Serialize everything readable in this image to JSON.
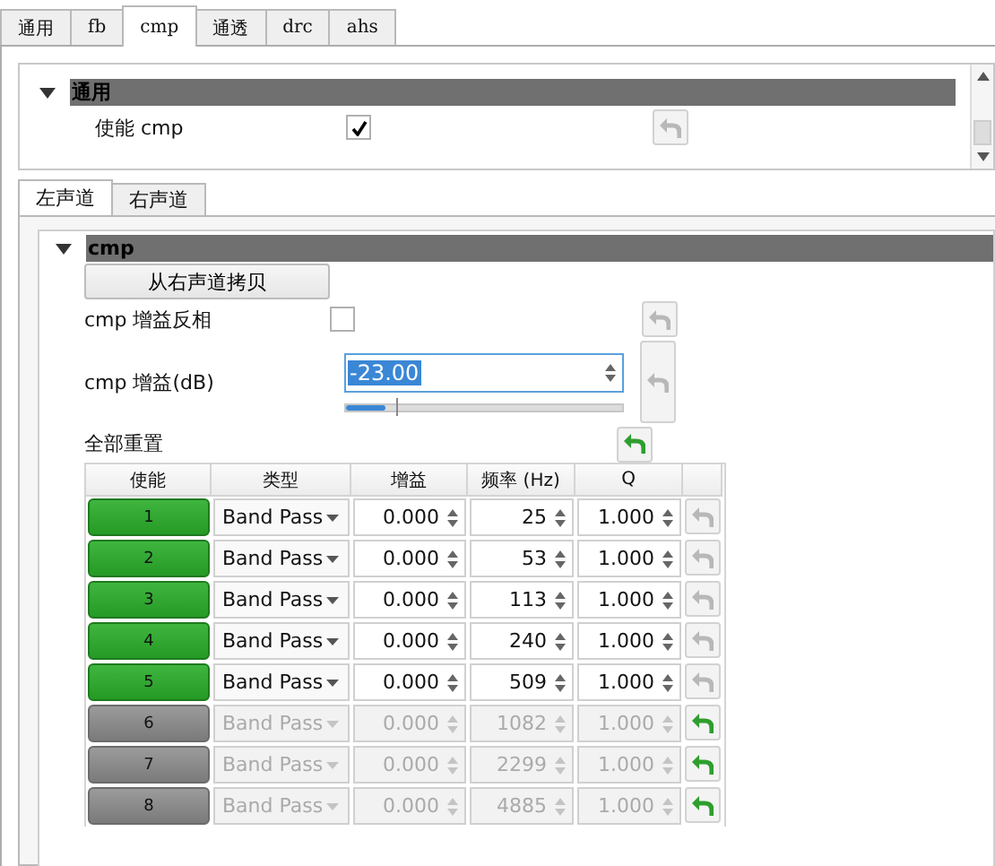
{
  "top_tabs": [
    {
      "label": "通用",
      "selected": false
    },
    {
      "label": "fb",
      "selected": false
    },
    {
      "label": "cmp",
      "selected": true
    },
    {
      "label": "通透",
      "selected": false
    },
    {
      "label": "drc",
      "selected": false
    },
    {
      "label": "ahs",
      "selected": false
    }
  ],
  "general_group": {
    "title": "通用",
    "expanded": true,
    "rows": [
      {
        "label": "使能 cmp",
        "checked": true,
        "modified": false
      }
    ]
  },
  "channel_tabs": [
    {
      "label": "左声道",
      "selected": true
    },
    {
      "label": "右声道",
      "selected": false
    }
  ],
  "cmp_group": {
    "title": "cmp",
    "expanded": true,
    "copy_button": "从右声道拷贝",
    "invert": {
      "label": "cmp 增益反相",
      "checked": false,
      "modified": false
    },
    "gain": {
      "label": "cmp 增益(dB)",
      "value": "-23.00",
      "level": 0.14,
      "modified": false
    },
    "reset_all": {
      "label": "全部重置",
      "modified": true
    },
    "bands": {
      "columns": [
        "使能",
        "类型",
        "增益",
        "频率 (Hz)",
        "Q"
      ],
      "rows": [
        {
          "index": "1",
          "enabled": true,
          "type": "Band Pass",
          "gain": "0.000",
          "frequency": "25",
          "q": "1.000",
          "modified": false
        },
        {
          "index": "2",
          "enabled": true,
          "type": "Band Pass",
          "gain": "0.000",
          "frequency": "53",
          "q": "1.000",
          "modified": false
        },
        {
          "index": "3",
          "enabled": true,
          "type": "Band Pass",
          "gain": "0.000",
          "frequency": "113",
          "q": "1.000",
          "modified": false
        },
        {
          "index": "4",
          "enabled": true,
          "type": "Band Pass",
          "gain": "0.000",
          "frequency": "240",
          "q": "1.000",
          "modified": false
        },
        {
          "index": "5",
          "enabled": true,
          "type": "Band Pass",
          "gain": "0.000",
          "frequency": "509",
          "q": "1.000",
          "modified": false
        },
        {
          "index": "6",
          "enabled": false,
          "type": "Band Pass",
          "gain": "0.000",
          "frequency": "1082",
          "q": "1.000",
          "modified": true
        },
        {
          "index": "7",
          "enabled": false,
          "type": "Band Pass",
          "gain": "0.000",
          "frequency": "2299",
          "q": "1.000",
          "modified": true
        },
        {
          "index": "8",
          "enabled": false,
          "type": "Band Pass",
          "gain": "0.000",
          "frequency": "4885",
          "q": "1.000",
          "modified": true
        }
      ]
    }
  }
}
